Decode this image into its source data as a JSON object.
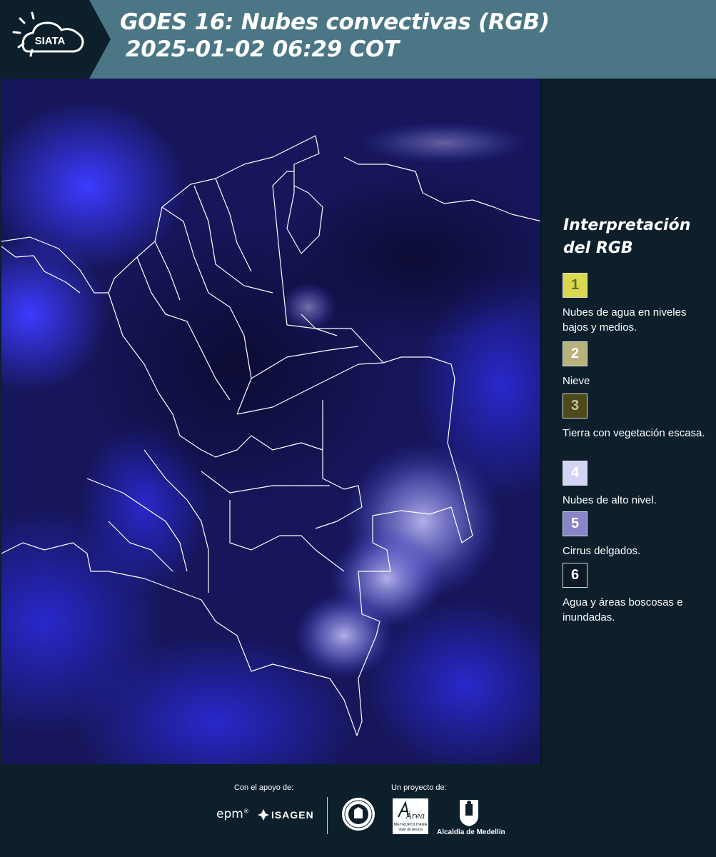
{
  "header": {
    "logo_text": "SIATA",
    "title_line1": "GOES 16: Nubes convectivas (RGB)",
    "title_line2": "2025-01-02 06:29 COT"
  },
  "legend": {
    "title_line1": "Interpretación",
    "title_line2": "del RGB",
    "items": [
      {
        "number": "1",
        "color": "#d9d94f",
        "label": "Nubes de agua en niveles bajos y medios."
      },
      {
        "number": "2",
        "color": "#b7b37a",
        "label": "Nieve"
      },
      {
        "number": "3",
        "color": "#4d4a1a",
        "label": "Tierra con vegetación escasa."
      },
      {
        "number": "4",
        "color": "#d4d4f5",
        "label": "Nubes de alto nivel."
      },
      {
        "number": "5",
        "color": "#8886c9",
        "label": "Cirrus delgados."
      },
      {
        "number": "6",
        "color": "#0d1a25",
        "label": "Agua y áreas boscosas e inundadas."
      }
    ]
  },
  "footer": {
    "support_label": "Con el apoyo de:",
    "project_label": "Un proyecto de:",
    "sponsors": [
      "epm",
      "ISAGEN"
    ],
    "area_logo_title": "Área",
    "area_logo_line1": "METROPOLITANA",
    "area_logo_line2": "Valle de Aburrá",
    "alcaldia_label": "Alcaldía de Medellín"
  },
  "colors": {
    "header_bg": "#4a7685",
    "panel_bg": "#0c1f2b",
    "map_dark_blue": "#14124a",
    "map_bright_blue": "#3d3df0",
    "border_lines": "#ffffff"
  }
}
